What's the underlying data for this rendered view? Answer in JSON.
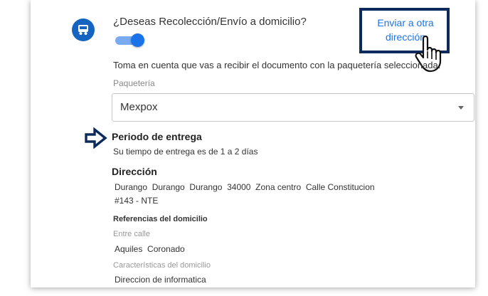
{
  "shipping": {
    "question": "¿Deseas Recolección/Envío a domicilio?",
    "toggle_on": true,
    "send_other_address_line1": "Enviar a otra",
    "send_other_address_line2": "dirección",
    "notice": "Toma en cuenta que vas a recibir el documento con la paquetería seleccionada.",
    "carrier_label": "Paquetería",
    "carrier_value": "Mexpox"
  },
  "delivery": {
    "period_title": "Periodo de entrega",
    "period_text": "Su tiempo de entrega es de 1 a 2 días"
  },
  "address": {
    "title": "Dirección",
    "line1": "Durango  Durango  Durango  34000  Zona centro  Calle Constitucion",
    "line2": "#143 - NTE",
    "references_title": "Referencias del domicilio",
    "between_streets_label": "Entre calle",
    "between_streets_value": "Aquiles  Coronado",
    "characteristics_label": "Características del domicilio",
    "characteristics_value": "Direccion de informatica"
  },
  "icons": {
    "delivery": "delivery-truck-icon",
    "pointer": "hand-pointer-icon",
    "arrow": "right-arrow-icon"
  },
  "colors": {
    "accent": "#1a73e8",
    "icon_bg": "#1565c0",
    "highlight_border": "#0d2a5c"
  }
}
